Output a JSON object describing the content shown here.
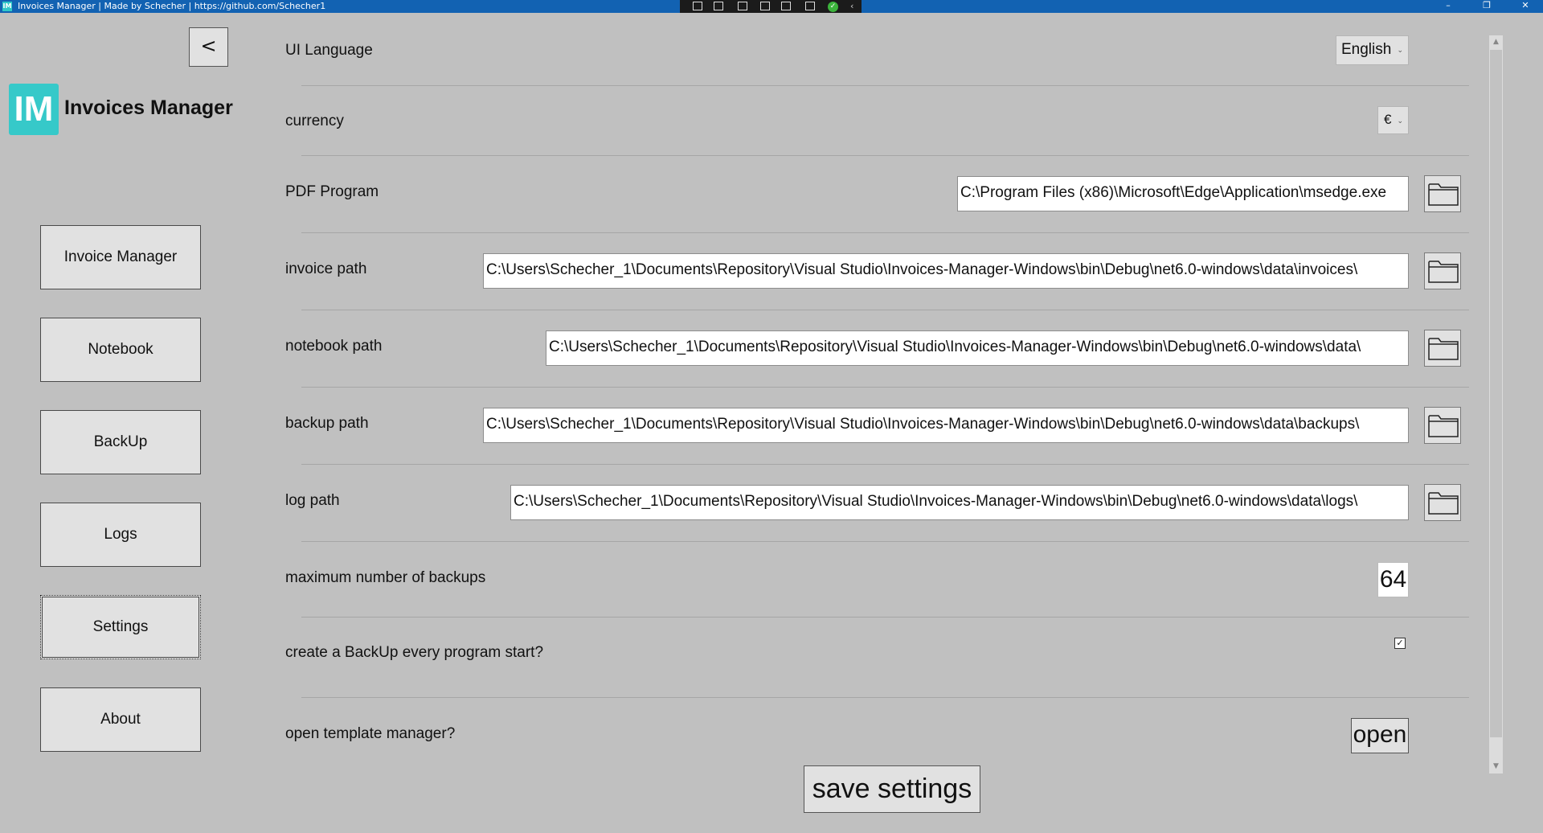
{
  "window": {
    "title": "Invoices Manager | Made by Schecher | https://github.com/Schecher1",
    "app_icon_text": "IM",
    "minimize": "–",
    "restore": "❐",
    "close": "✕"
  },
  "sidebar": {
    "back_label": "<",
    "logo_text": "IM",
    "app_name": "Invoices Manager",
    "nav": [
      {
        "label": "Invoice Manager"
      },
      {
        "label": "Notebook"
      },
      {
        "label": "BackUp"
      },
      {
        "label": "Logs"
      },
      {
        "label": "Settings",
        "active": true
      },
      {
        "label": "About"
      }
    ]
  },
  "settings": {
    "ui_language": {
      "label": "UI Language",
      "value": "English"
    },
    "currency": {
      "label": "currency",
      "value": "€"
    },
    "pdf_program": {
      "label": "PDF Program",
      "value": "C:\\Program Files (x86)\\Microsoft\\Edge\\Application\\msedge.exe"
    },
    "invoice_path": {
      "label": "invoice path",
      "value": "C:\\Users\\Schecher_1\\Documents\\Repository\\Visual Studio\\Invoices-Manager-Windows\\bin\\Debug\\net6.0-windows\\data\\invoices\\"
    },
    "notebook_path": {
      "label": "notebook path",
      "value": "C:\\Users\\Schecher_1\\Documents\\Repository\\Visual Studio\\Invoices-Manager-Windows\\bin\\Debug\\net6.0-windows\\data\\"
    },
    "backup_path": {
      "label": "backup path",
      "value": "C:\\Users\\Schecher_1\\Documents\\Repository\\Visual Studio\\Invoices-Manager-Windows\\bin\\Debug\\net6.0-windows\\data\\backups\\"
    },
    "log_path": {
      "label": "log path",
      "value": "C:\\Users\\Schecher_1\\Documents\\Repository\\Visual Studio\\Invoices-Manager-Windows\\bin\\Debug\\net6.0-windows\\data\\logs\\"
    },
    "max_backups": {
      "label": "maximum number of backups",
      "value": "64"
    },
    "backup_on_start": {
      "label": "create a BackUp every program start?",
      "checked": true,
      "check_glyph": "✓"
    },
    "template_manager": {
      "label": "open template manager?",
      "button_label": "open"
    },
    "save_label": "save settings"
  },
  "icons": {
    "folder": "folder-icon",
    "chevron": "chevron-down-icon"
  },
  "colors": {
    "background": "#c0c0c0",
    "titlebar": "#1262b2",
    "logo": "#36c9c9",
    "button": "#e1e1e1"
  }
}
